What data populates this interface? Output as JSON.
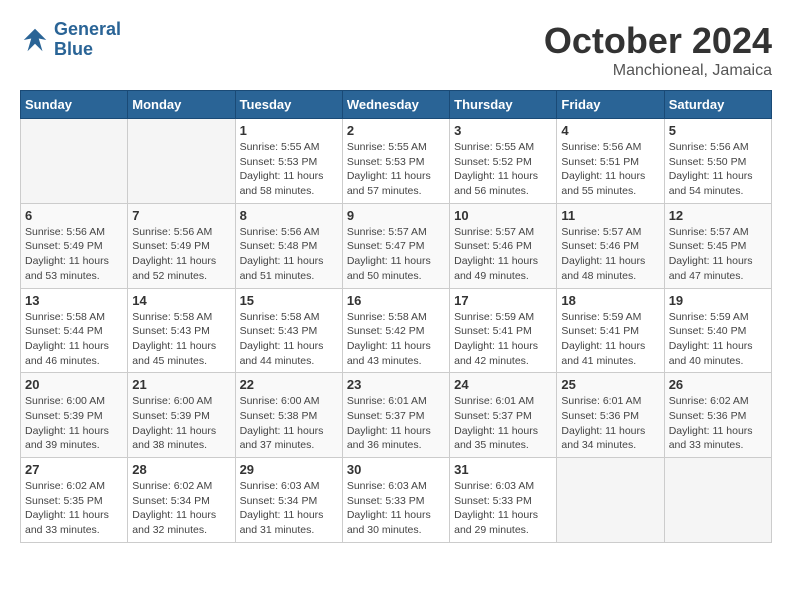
{
  "header": {
    "logo_line1": "General",
    "logo_line2": "Blue",
    "month": "October 2024",
    "location": "Manchioneal, Jamaica"
  },
  "weekdays": [
    "Sunday",
    "Monday",
    "Tuesday",
    "Wednesday",
    "Thursday",
    "Friday",
    "Saturday"
  ],
  "weeks": [
    [
      {
        "day": "",
        "info": ""
      },
      {
        "day": "",
        "info": ""
      },
      {
        "day": "1",
        "info": "Sunrise: 5:55 AM\nSunset: 5:53 PM\nDaylight: 11 hours and 58 minutes."
      },
      {
        "day": "2",
        "info": "Sunrise: 5:55 AM\nSunset: 5:53 PM\nDaylight: 11 hours and 57 minutes."
      },
      {
        "day": "3",
        "info": "Sunrise: 5:55 AM\nSunset: 5:52 PM\nDaylight: 11 hours and 56 minutes."
      },
      {
        "day": "4",
        "info": "Sunrise: 5:56 AM\nSunset: 5:51 PM\nDaylight: 11 hours and 55 minutes."
      },
      {
        "day": "5",
        "info": "Sunrise: 5:56 AM\nSunset: 5:50 PM\nDaylight: 11 hours and 54 minutes."
      }
    ],
    [
      {
        "day": "6",
        "info": "Sunrise: 5:56 AM\nSunset: 5:49 PM\nDaylight: 11 hours and 53 minutes."
      },
      {
        "day": "7",
        "info": "Sunrise: 5:56 AM\nSunset: 5:49 PM\nDaylight: 11 hours and 52 minutes."
      },
      {
        "day": "8",
        "info": "Sunrise: 5:56 AM\nSunset: 5:48 PM\nDaylight: 11 hours and 51 minutes."
      },
      {
        "day": "9",
        "info": "Sunrise: 5:57 AM\nSunset: 5:47 PM\nDaylight: 11 hours and 50 minutes."
      },
      {
        "day": "10",
        "info": "Sunrise: 5:57 AM\nSunset: 5:46 PM\nDaylight: 11 hours and 49 minutes."
      },
      {
        "day": "11",
        "info": "Sunrise: 5:57 AM\nSunset: 5:46 PM\nDaylight: 11 hours and 48 minutes."
      },
      {
        "day": "12",
        "info": "Sunrise: 5:57 AM\nSunset: 5:45 PM\nDaylight: 11 hours and 47 minutes."
      }
    ],
    [
      {
        "day": "13",
        "info": "Sunrise: 5:58 AM\nSunset: 5:44 PM\nDaylight: 11 hours and 46 minutes."
      },
      {
        "day": "14",
        "info": "Sunrise: 5:58 AM\nSunset: 5:43 PM\nDaylight: 11 hours and 45 minutes."
      },
      {
        "day": "15",
        "info": "Sunrise: 5:58 AM\nSunset: 5:43 PM\nDaylight: 11 hours and 44 minutes."
      },
      {
        "day": "16",
        "info": "Sunrise: 5:58 AM\nSunset: 5:42 PM\nDaylight: 11 hours and 43 minutes."
      },
      {
        "day": "17",
        "info": "Sunrise: 5:59 AM\nSunset: 5:41 PM\nDaylight: 11 hours and 42 minutes."
      },
      {
        "day": "18",
        "info": "Sunrise: 5:59 AM\nSunset: 5:41 PM\nDaylight: 11 hours and 41 minutes."
      },
      {
        "day": "19",
        "info": "Sunrise: 5:59 AM\nSunset: 5:40 PM\nDaylight: 11 hours and 40 minutes."
      }
    ],
    [
      {
        "day": "20",
        "info": "Sunrise: 6:00 AM\nSunset: 5:39 PM\nDaylight: 11 hours and 39 minutes."
      },
      {
        "day": "21",
        "info": "Sunrise: 6:00 AM\nSunset: 5:39 PM\nDaylight: 11 hours and 38 minutes."
      },
      {
        "day": "22",
        "info": "Sunrise: 6:00 AM\nSunset: 5:38 PM\nDaylight: 11 hours and 37 minutes."
      },
      {
        "day": "23",
        "info": "Sunrise: 6:01 AM\nSunset: 5:37 PM\nDaylight: 11 hours and 36 minutes."
      },
      {
        "day": "24",
        "info": "Sunrise: 6:01 AM\nSunset: 5:37 PM\nDaylight: 11 hours and 35 minutes."
      },
      {
        "day": "25",
        "info": "Sunrise: 6:01 AM\nSunset: 5:36 PM\nDaylight: 11 hours and 34 minutes."
      },
      {
        "day": "26",
        "info": "Sunrise: 6:02 AM\nSunset: 5:36 PM\nDaylight: 11 hours and 33 minutes."
      }
    ],
    [
      {
        "day": "27",
        "info": "Sunrise: 6:02 AM\nSunset: 5:35 PM\nDaylight: 11 hours and 33 minutes."
      },
      {
        "day": "28",
        "info": "Sunrise: 6:02 AM\nSunset: 5:34 PM\nDaylight: 11 hours and 32 minutes."
      },
      {
        "day": "29",
        "info": "Sunrise: 6:03 AM\nSunset: 5:34 PM\nDaylight: 11 hours and 31 minutes."
      },
      {
        "day": "30",
        "info": "Sunrise: 6:03 AM\nSunset: 5:33 PM\nDaylight: 11 hours and 30 minutes."
      },
      {
        "day": "31",
        "info": "Sunrise: 6:03 AM\nSunset: 5:33 PM\nDaylight: 11 hours and 29 minutes."
      },
      {
        "day": "",
        "info": ""
      },
      {
        "day": "",
        "info": ""
      }
    ]
  ]
}
